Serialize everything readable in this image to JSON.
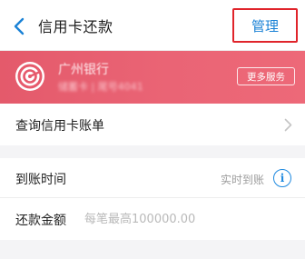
{
  "header": {
    "title": "信用卡还款",
    "manage_label": "管理"
  },
  "bank": {
    "name": "广州银行",
    "subtitle": "储蓄卡 | 尾号4041",
    "more_services_label": "更多服务",
    "brand_color": "#e85f70"
  },
  "query_bill": {
    "label": "查询信用卡账单"
  },
  "arrival": {
    "label": "到账时间",
    "value": "实时到账",
    "info_icon_glyph": "i"
  },
  "amount": {
    "label": "还款金额",
    "placeholder": "每笔最高100000.00",
    "value": ""
  },
  "colors": {
    "accent_blue": "#1a82d6",
    "highlight_red": "#e0242b"
  }
}
